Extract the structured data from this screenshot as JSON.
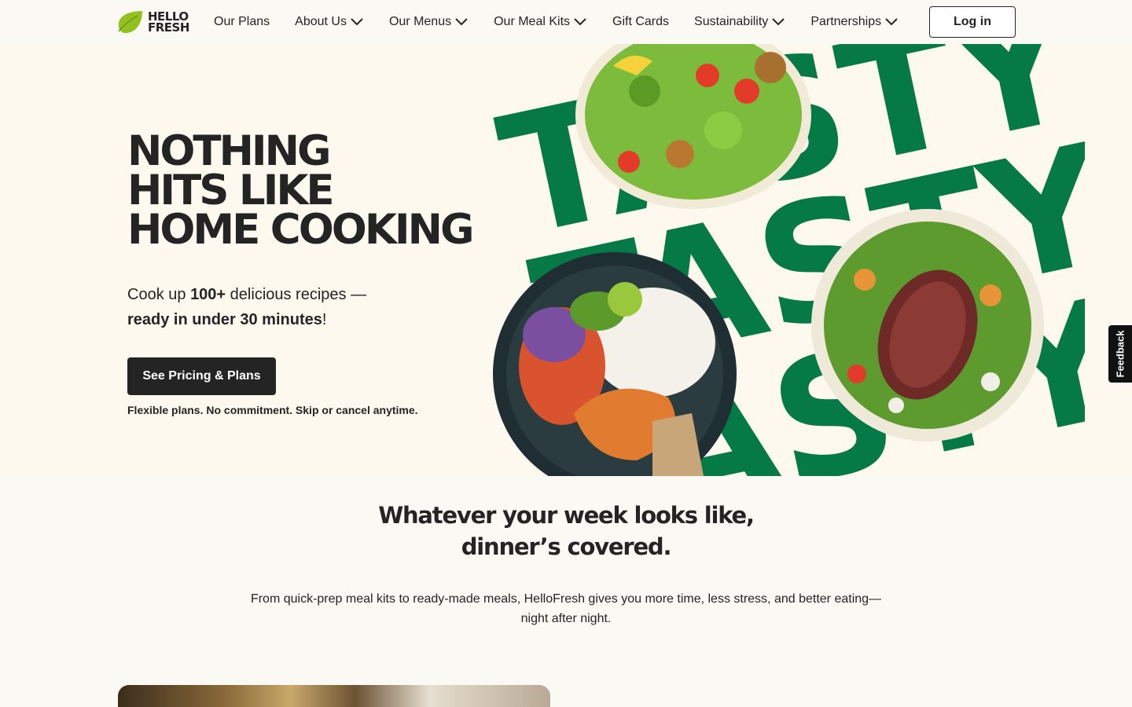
{
  "brand": {
    "logo_line1": "HELLO",
    "logo_line2": "FRESH",
    "accent": "#91c11e",
    "dark": "#242424",
    "tasty_green": "#067a46"
  },
  "nav": {
    "items": [
      {
        "label": "Our Plans",
        "dropdown": false
      },
      {
        "label": "About Us",
        "dropdown": true
      },
      {
        "label": "Our Menus",
        "dropdown": true
      },
      {
        "label": "Our Meal Kits",
        "dropdown": true
      },
      {
        "label": "Gift Cards",
        "dropdown": false
      },
      {
        "label": "Sustainability",
        "dropdown": true
      },
      {
        "label": "Partnerships",
        "dropdown": true
      }
    ],
    "login_label": "Log in"
  },
  "hero": {
    "title_lines": [
      "NOTHING",
      "HITS LIKE",
      "HOME COOKING"
    ],
    "sub_prefix": "Cook up ",
    "sub_bold": "100+",
    "sub_mid": " delicious recipes —",
    "sub_bold2": "ready in under 30 minutes",
    "sub_suffix": "!",
    "cta_label": "See Pricing & Plans",
    "note": "Flexible plans. No commitment. Skip or cancel anytime.",
    "art_word": "TASTY"
  },
  "feedback_label": "Feedback",
  "section": {
    "title_line1": "Whatever your week looks like,",
    "title_line2": "dinner’s covered.",
    "body": "From quick-prep meal kits to ready-made meals, HelloFresh gives you more time, less stress, and better eating—night after night."
  }
}
